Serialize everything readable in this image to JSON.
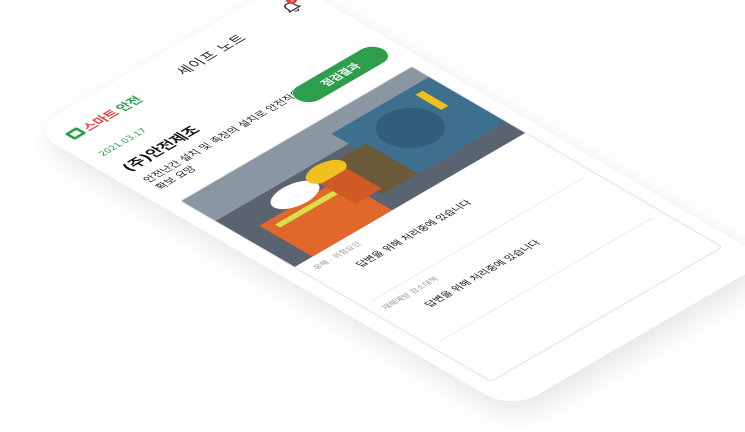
{
  "header": {
    "logo_text_a": "스마트",
    "logo_text_b": "안전",
    "title": "세이프 노트",
    "notification_count": "1"
  },
  "report": {
    "date": "2021.03.17",
    "company": "(주)안전제조",
    "description": "안전난간 설치 및 족장의 설치로 안전작업 확보 요망",
    "result_button": "점검결과"
  },
  "items": [
    {
      "category": "유해 · 위험요인",
      "status": "답변을 위해 처리중에 있습니다"
    },
    {
      "category": "재해예방 감소대책",
      "status": "답변을 위해 처리중에 있습니다"
    }
  ],
  "colors": {
    "brand_green": "#2e9d4c",
    "brand_red": "#e23b3b"
  },
  "photo_icon": "worker-photo"
}
